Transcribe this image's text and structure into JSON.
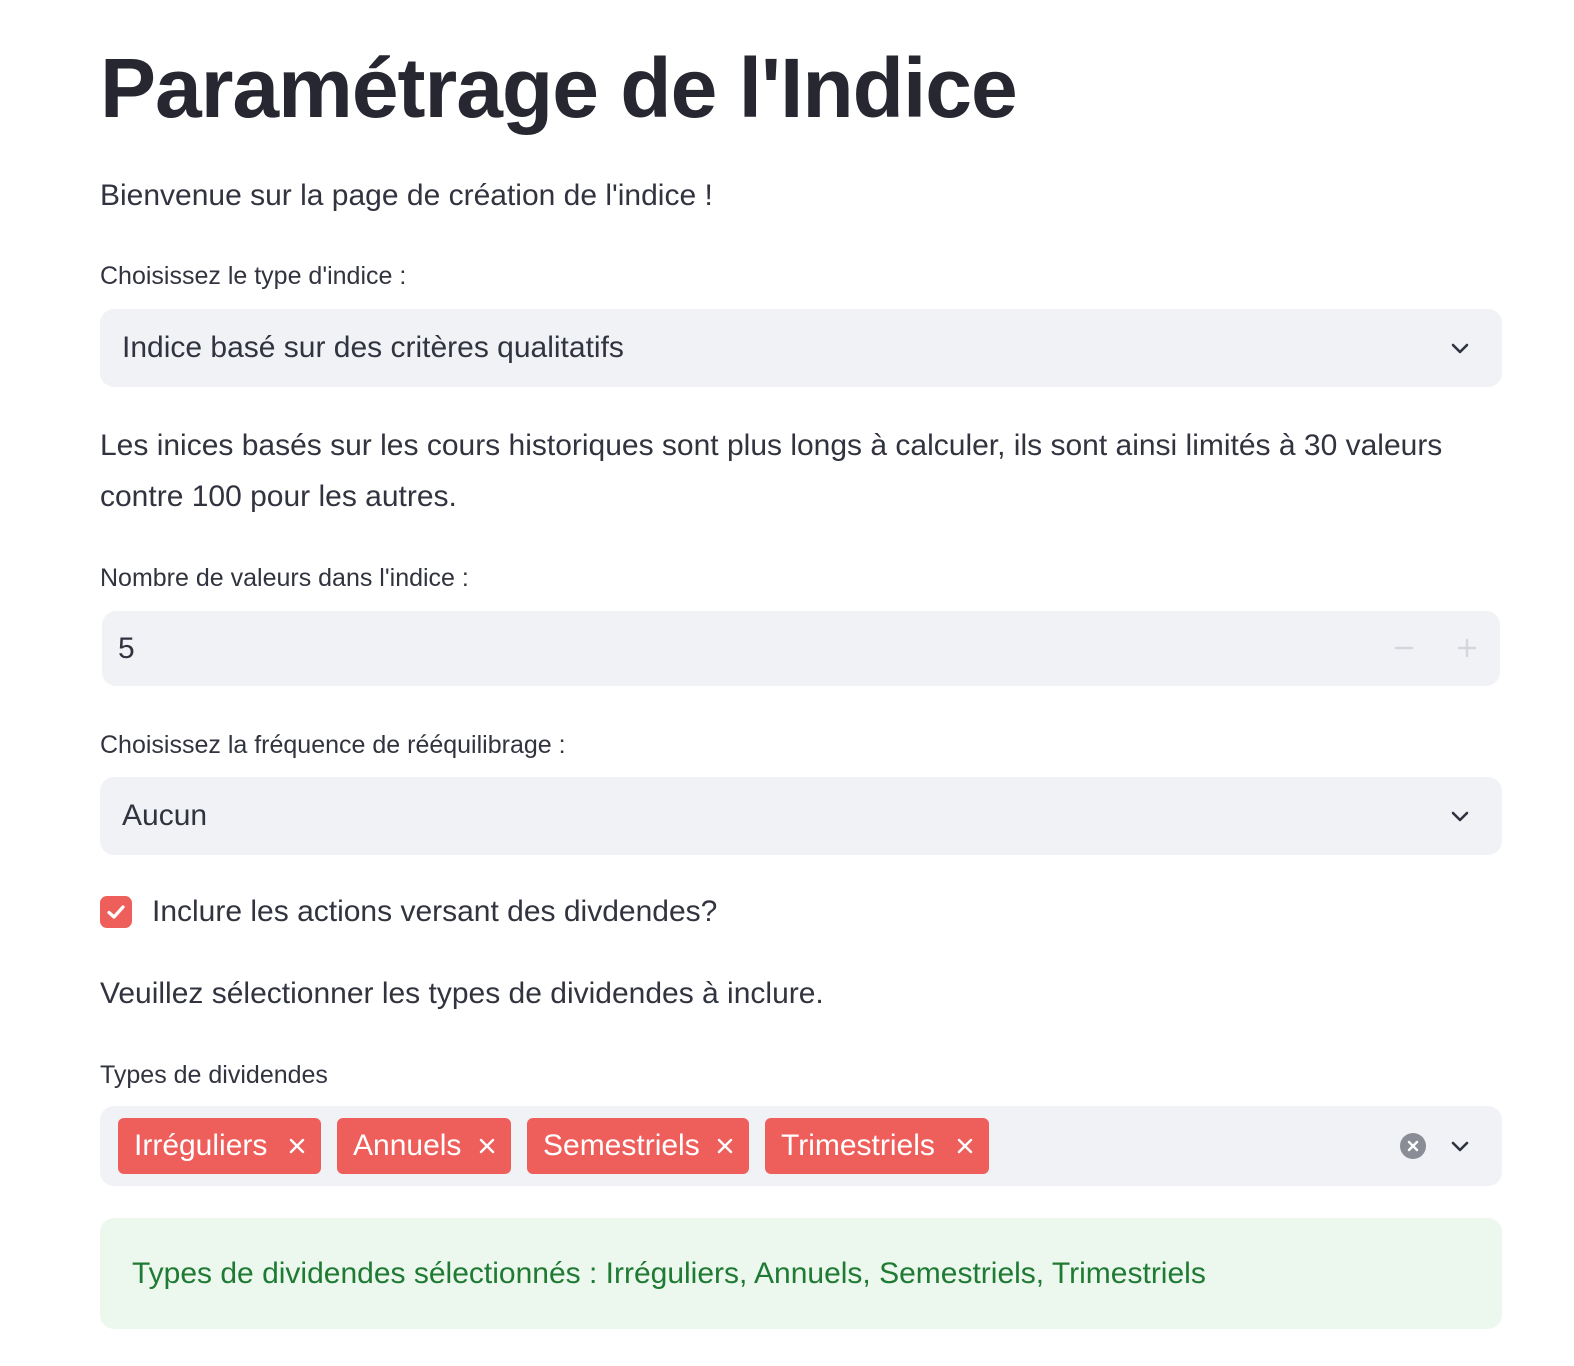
{
  "page": {
    "title": "Paramétrage de l'Indice",
    "welcome": "Bienvenue sur la page de création de l'indice !"
  },
  "index_type": {
    "label": "Choisissez le type d'indice :",
    "selected": "Indice basé sur des critères qualitatifs",
    "icon": "chevron-down-icon"
  },
  "info_text": {
    "line1": "Les inices basés sur les cours historiques sont plus longs à calculer, ils sont ainsi limités à 30 valeurs",
    "line2": "contre 100 pour les autres."
  },
  "num_values": {
    "label": "Nombre de valeurs dans l'indice :",
    "value": "5",
    "decrement_icon": "minus-icon",
    "increment_icon": "plus-icon"
  },
  "rebalancing": {
    "label": "Choisissez la fréquence de rééquilibrage :",
    "selected": "Aucun",
    "icon": "chevron-down-icon"
  },
  "dividends_checkbox": {
    "label": "Inclure les actions versant des divdendes?",
    "checked": true
  },
  "dividend_instruction": "Veuillez sélectionner les types de dividendes à inclure.",
  "dividend_types": {
    "label": "Types de dividendes",
    "chips": [
      "Irréguliers",
      "Annuels",
      "Semestriels",
      "Trimestriels"
    ],
    "clear_icon": "clear-all-icon",
    "dropdown_icon": "chevron-down-icon"
  },
  "success_message": "Types de dividendes sélectionnés : Irréguliers, Annuels, Semestriels, Trimestriels",
  "colors": {
    "accent": "#ee5e5b",
    "input_bg": "#f0f2f6",
    "success_bg": "#ecf7ee",
    "success_text": "#1f7a33",
    "text": "#31333f"
  }
}
